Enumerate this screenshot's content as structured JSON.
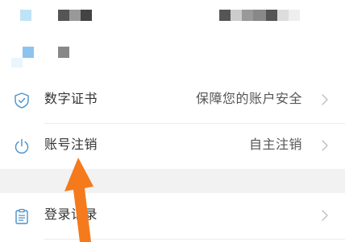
{
  "rows": [
    {
      "label": "数字证书",
      "value": "保障您的账户安全",
      "icon": "shield-check-icon"
    },
    {
      "label": "账号注销",
      "value": "自主注销",
      "icon": "power-icon"
    },
    {
      "label": "登录记录",
      "value": "",
      "icon": "clipboard-icon"
    }
  ],
  "colors": {
    "icon": "#4a90c8",
    "arrow": "#f57a1c",
    "chevron": "#bdbdbd",
    "section_gap": "#f2f2f2"
  },
  "annotation": "arrow pointing to 账号注销"
}
